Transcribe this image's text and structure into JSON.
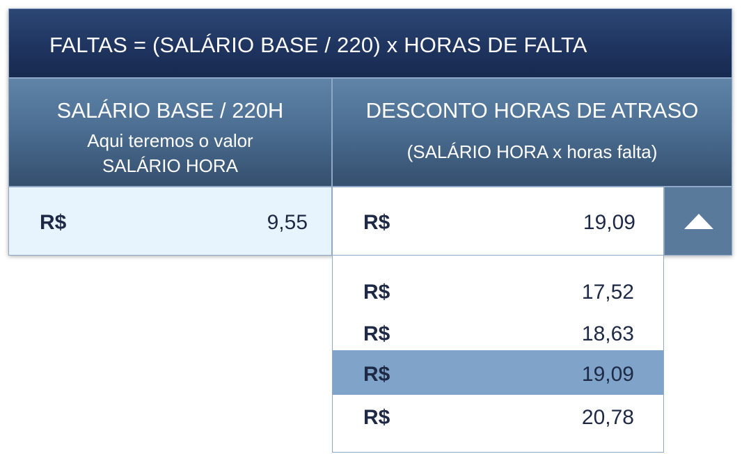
{
  "title": "FALTAS = (SALÁRIO BASE / 220) x HORAS DE FALTA",
  "left_header": {
    "main": "SALÁRIO BASE / 220H",
    "sub_line1": "Aqui teremos o valor",
    "sub_line2": "SALÁRIO HORA"
  },
  "right_header": {
    "main": "DESCONTO HORAS DE ATRASO",
    "sub": "(SALÁRIO HORA x horas falta)"
  },
  "left_cell": {
    "currency": "R$",
    "value": "9,55"
  },
  "dropdown": {
    "currency": "R$",
    "selected_value": "19,09",
    "expanded": true,
    "toggle_icon": "triangle-up-icon",
    "options": [
      {
        "currency": "R$",
        "value": "17,52"
      },
      {
        "currency": "R$",
        "value": "18,63"
      },
      {
        "currency": "R$",
        "value": "19,09",
        "selected": true
      },
      {
        "currency": "R$",
        "value": "20,78"
      }
    ]
  },
  "colors": {
    "title_bg": "#1f3560",
    "header_bg": "#4c6f93",
    "left_cell_bg": "#e8f4fd",
    "selected_option_bg": "#7fa3c9",
    "button_bg": "#5a7a9c",
    "text_dark": "#1e2a45"
  }
}
